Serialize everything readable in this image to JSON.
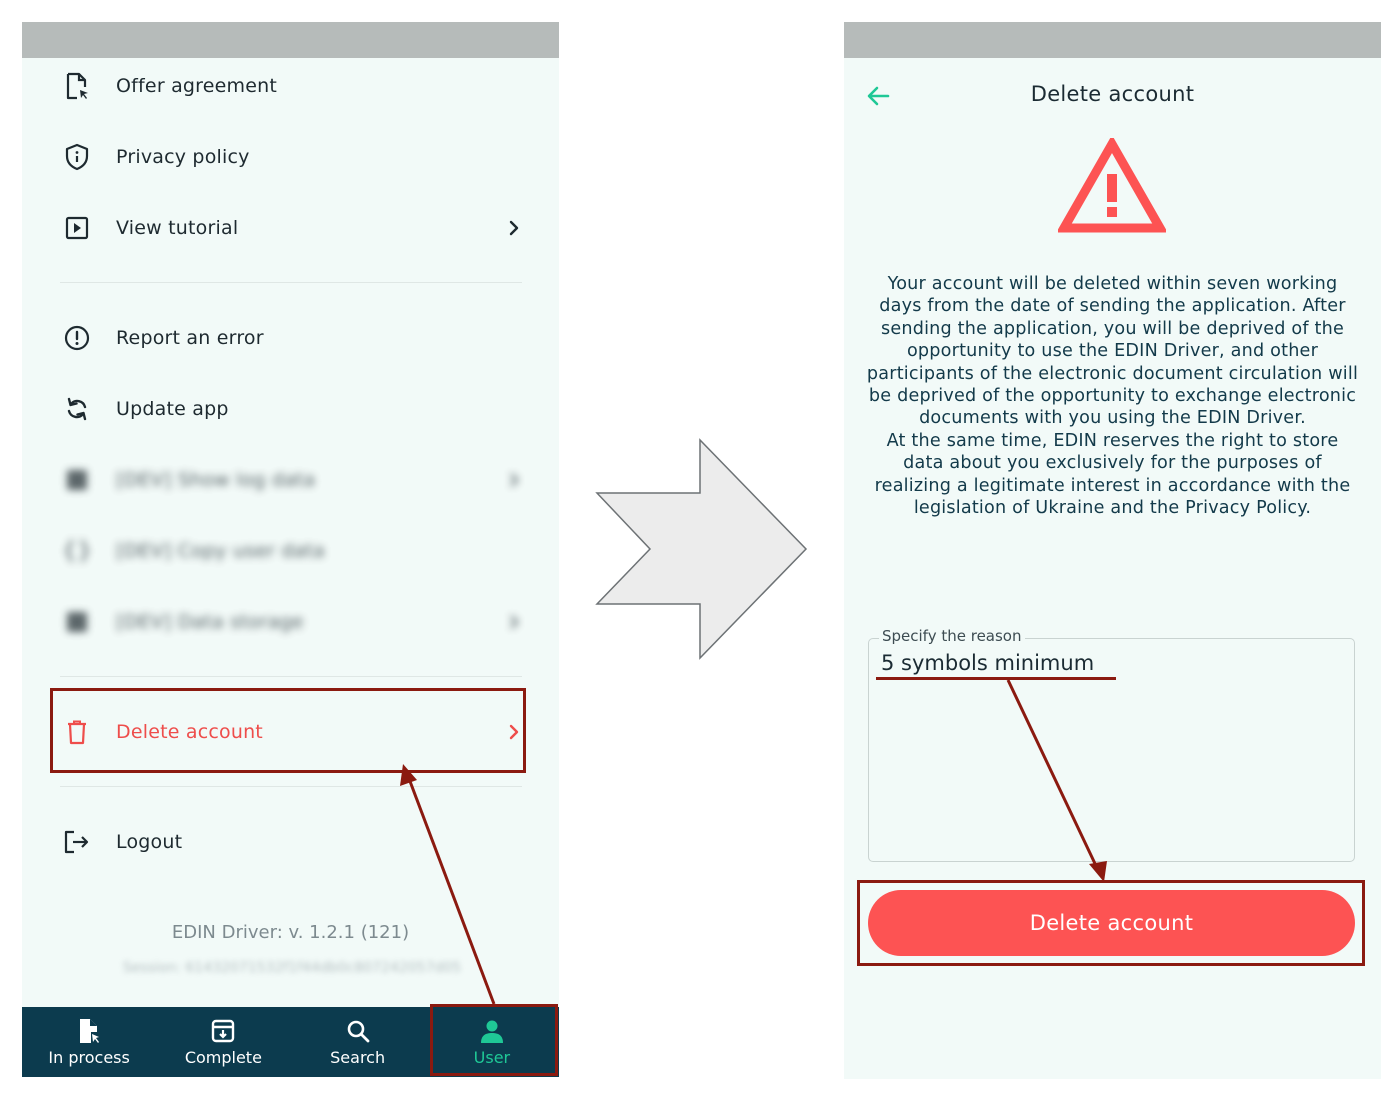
{
  "colors": {
    "accent": "#1fc896",
    "danger": "#fd5353",
    "annotation": "#8b1a10",
    "nav_background": "#0c3b4e",
    "screen_background": "#f2faf8"
  },
  "menu": {
    "items": [
      {
        "label": "Offer agreement",
        "icon": "document-cursor-icon"
      },
      {
        "label": "Privacy policy",
        "icon": "shield-info-icon"
      },
      {
        "label": "View tutorial",
        "icon": "play-square-icon"
      },
      {
        "label": "Report an error",
        "icon": "alert-circle-icon"
      },
      {
        "label": "Update app",
        "icon": "sync-icon"
      },
      {
        "label": "[DEV] Show log data",
        "icon": "log-icon"
      },
      {
        "label": "[DEV] Copy user data",
        "icon": "braces-icon"
      },
      {
        "label": "[DEV] Data storage",
        "icon": "storage-icon"
      },
      {
        "label": "Delete account",
        "icon": "trash-icon"
      },
      {
        "label": "Logout",
        "icon": "logout-icon"
      }
    ]
  },
  "footer": {
    "version": "EDIN Driver: v. 1.2.1 (121)",
    "session": "Session: 61432071532f1f44db0c807242057d05"
  },
  "bottom_nav": {
    "tabs": [
      {
        "label": "In process",
        "icon": "document-cursor-icon"
      },
      {
        "label": "Complete",
        "icon": "archive-icon"
      },
      {
        "label": "Search",
        "icon": "search-icon"
      },
      {
        "label": "User",
        "icon": "user-icon",
        "active": true
      }
    ]
  },
  "delete_screen": {
    "title": "Delete account",
    "message_p1": "Your account will be deleted within seven working days from the date of sending the application. After sending the application, you will be deprived of the opportunity to use the EDIN Driver, and other participants of the electronic document circulation will be deprived of the opportunity to exchange electronic documents with you using the EDIN Driver.",
    "message_p2": "At the same time, EDIN reserves the right to store data about you exclusively for the purposes of realizing a legitimate interest in accordance with the legislation of Ukraine and the Privacy Policy.",
    "reason_label": "Specify the reason",
    "reason_placeholder": "5 symbols minimum",
    "button_label": "Delete account"
  }
}
